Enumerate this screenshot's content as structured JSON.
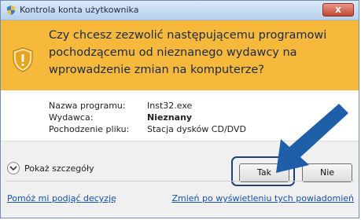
{
  "window": {
    "title": "Kontrola konta użytkownika",
    "close_label": "x"
  },
  "banner": {
    "question": "Czy chcesz zezwolić następującemu programowi pochodzącemu od nieznanego wydawcy na wprowadzenie zmian na komputerze?"
  },
  "details": [
    {
      "label": "Nazwa programu:",
      "value": "Inst32.exe",
      "bold": false
    },
    {
      "label": "Wydawca:",
      "value": "Nieznany",
      "bold": true
    },
    {
      "label": "Pochodzenie pliku:",
      "value": "Stacja dysków CD/DVD",
      "bold": false
    }
  ],
  "footer": {
    "show_details_label": "Pokaż szczegóły",
    "yes_label": "Tak",
    "no_label": "Nie",
    "help_link": "Pomóż mi podjąć decyzję",
    "change_link": "Zmień po wyświetleniu tych powiadomień"
  },
  "colors": {
    "banner": "#f6b93b",
    "link": "#1452a8",
    "arrow": "#1f5fa8"
  }
}
